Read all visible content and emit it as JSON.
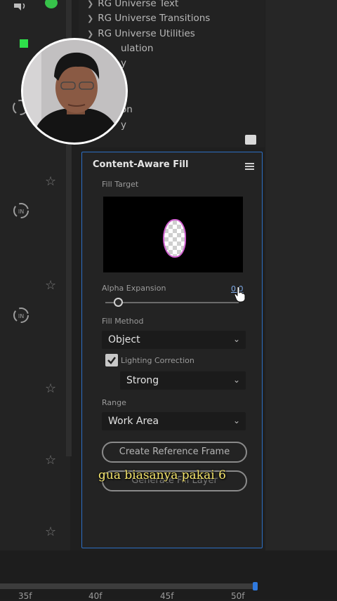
{
  "effects_list": {
    "items": [
      "RG Universe Text",
      "RG Universe Transitions",
      "RG Universe Utilities",
      "ulation",
      "y",
      "on",
      "y"
    ]
  },
  "content_aware_fill": {
    "title": "Content-Aware Fill",
    "fill_target_label": "Fill Target",
    "alpha_expansion_label": "Alpha Expansion",
    "alpha_expansion_value": "0.0",
    "fill_method_label": "Fill Method",
    "fill_method_value": "Object",
    "lighting_correction_label": "Lighting Correction",
    "lighting_correction_checked": true,
    "lighting_strength_value": "Strong",
    "range_label": "Range",
    "range_value": "Work Area",
    "create_reference_frame_button": "Create Reference Frame",
    "generate_fill_layer_button": "Generate Fill Layer"
  },
  "subtitle": "gua biasanya pakai 6",
  "timeline": {
    "ticks": [
      "35f",
      "40f",
      "45f",
      "50f"
    ]
  },
  "colors": {
    "accent": "#2d6fc4",
    "subtitle": "#f3e36b",
    "status_green": "#37c24a"
  }
}
